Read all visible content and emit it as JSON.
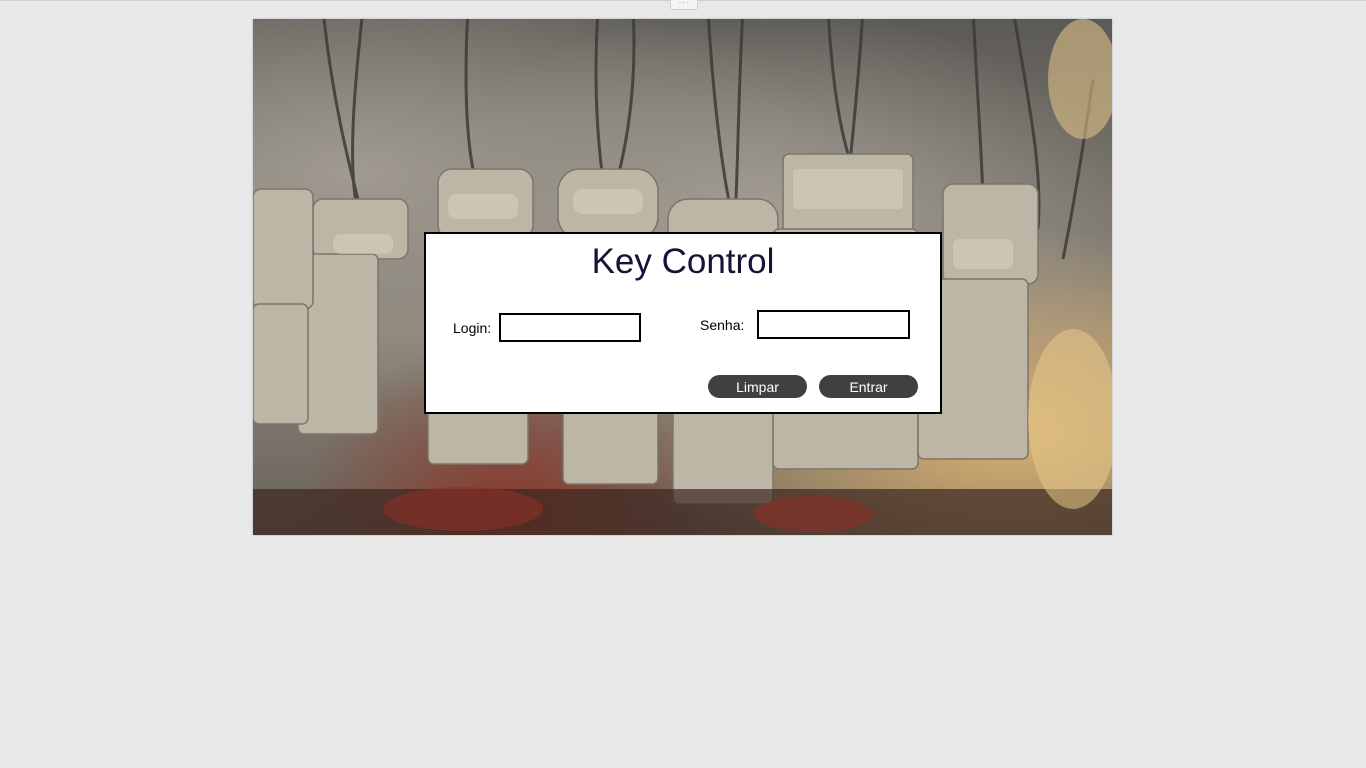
{
  "app": {
    "title": "Key Control"
  },
  "form": {
    "login_label": "Login:",
    "login_value": "",
    "senha_label": "Senha:",
    "senha_value": ""
  },
  "buttons": {
    "clear_label": "Limpar",
    "submit_label": "Entrar"
  },
  "colors": {
    "page_background": "#e8e8e8",
    "title_color": "#1b1035",
    "button_background": "#404040",
    "button_text": "#ffffff"
  }
}
